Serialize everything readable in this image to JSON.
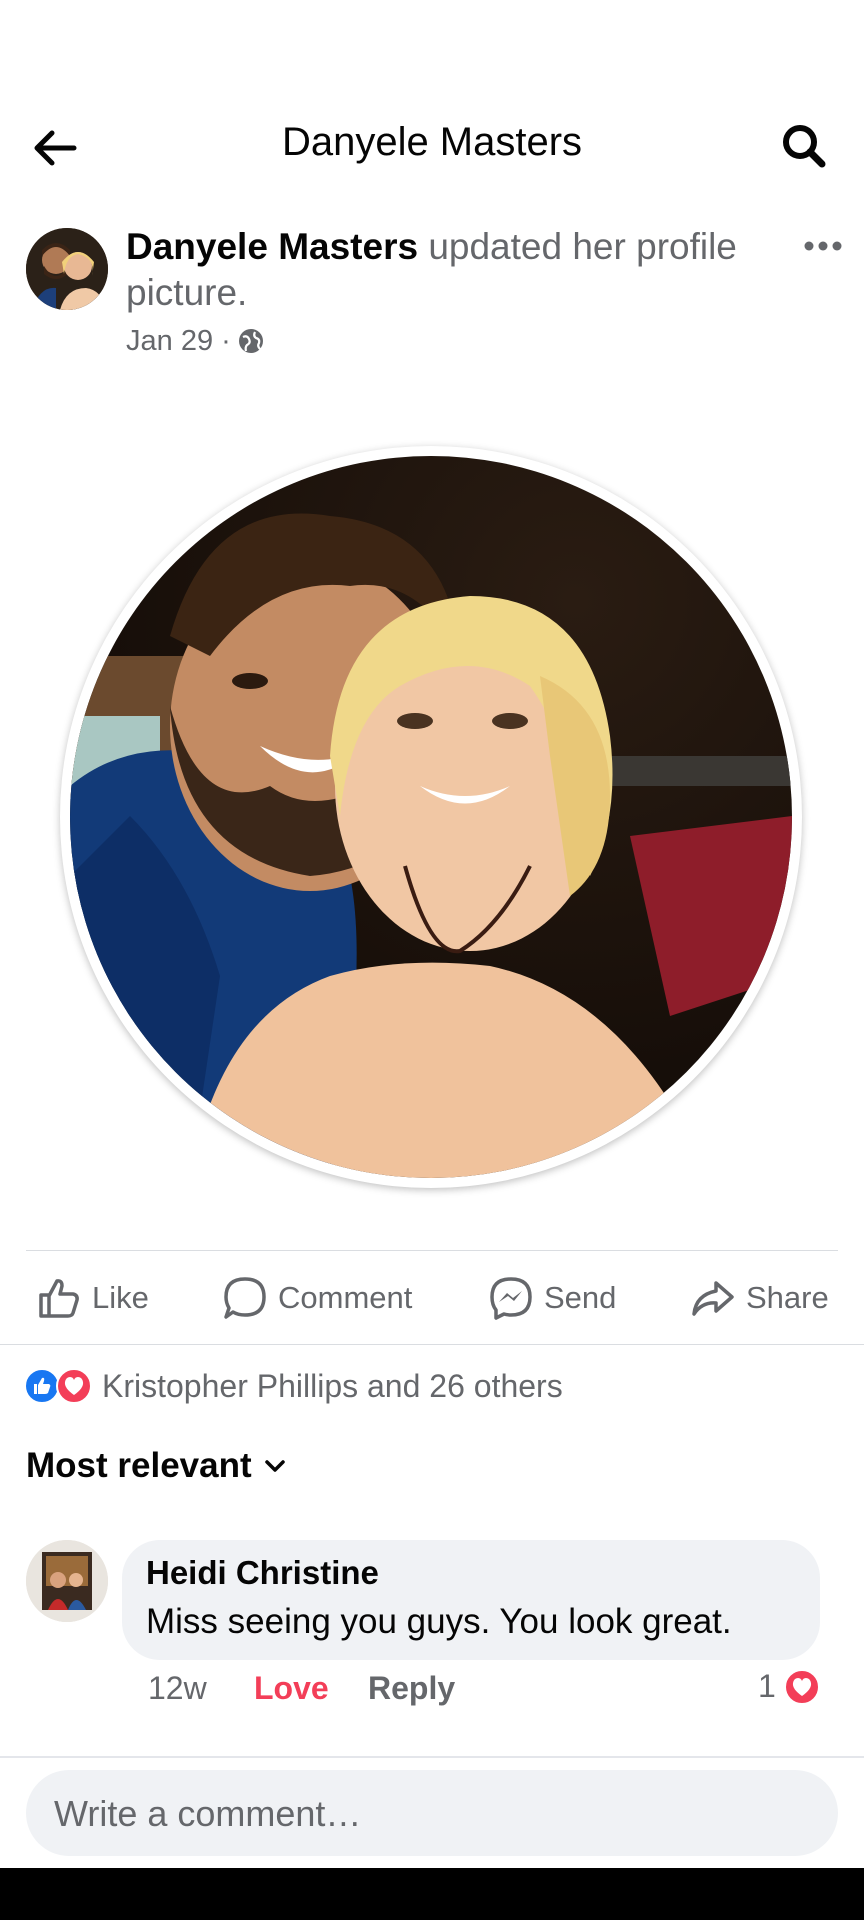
{
  "header": {
    "title": "Danyele Masters"
  },
  "post": {
    "author": "Danyele Masters",
    "action_text": "updated her profile picture.",
    "date": "Jan 29 ·",
    "privacy_icon": "globe-icon"
  },
  "actions": {
    "like": "Like",
    "comment": "Comment",
    "send": "Send",
    "share": "Share"
  },
  "reactions": {
    "summary": "Kristopher Phillips and 26 others"
  },
  "sort": {
    "label": "Most relevant"
  },
  "comments": [
    {
      "author": "Heidi Christine",
      "text": "Miss seeing you guys.  You look great.",
      "time": "12w",
      "reaction_label": "Love",
      "reply_label": "Reply",
      "reaction_count": "1"
    }
  ],
  "compose": {
    "placeholder": "Write a comment…"
  },
  "colors": {
    "like_blue": "#1877f2",
    "love_red": "#f33e58",
    "muted": "#65676b"
  }
}
